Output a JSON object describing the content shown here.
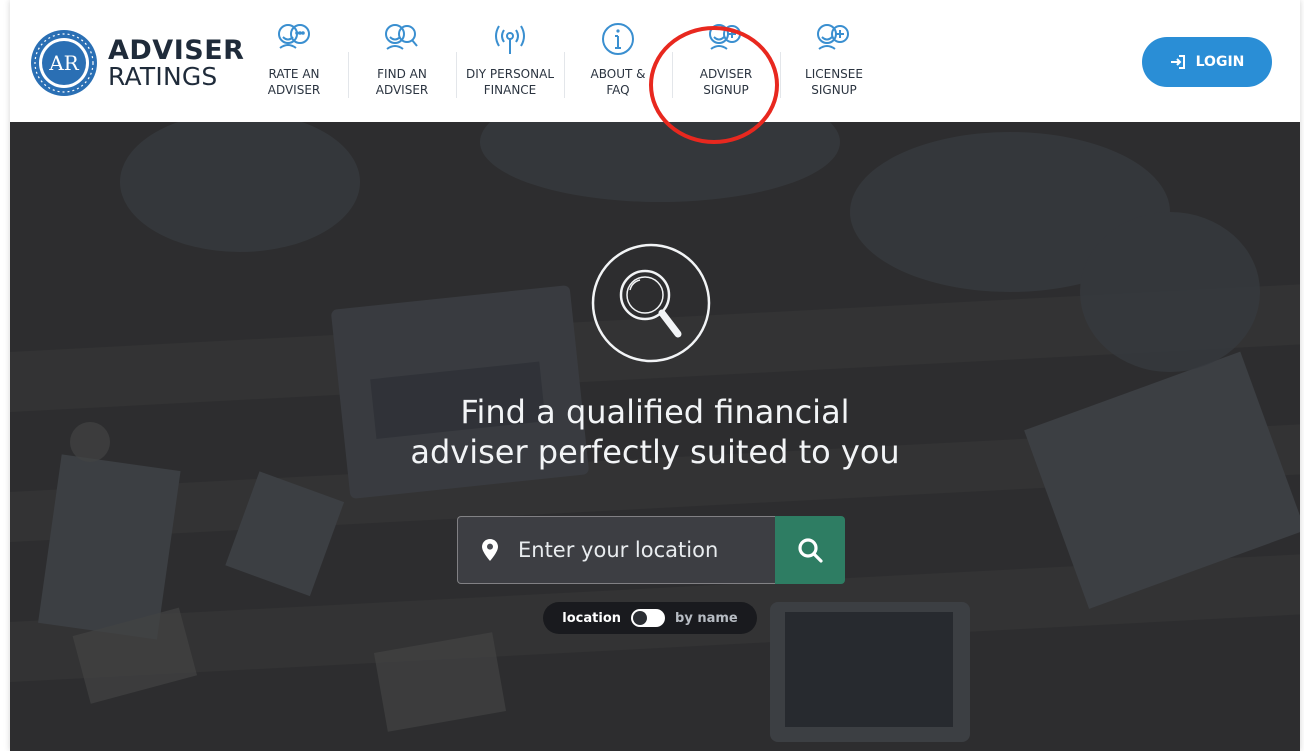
{
  "brand": {
    "seal_text": "AR",
    "name_line1": "ADVISER",
    "name_line2": "RATINGS",
    "seal_color": "#2a6fb4",
    "text_color": "#1f2b3a"
  },
  "nav": {
    "items": [
      {
        "line1": "RATE AN",
        "line2": "ADVISER",
        "icon": "people-chat-icon"
      },
      {
        "line1": "FIND AN",
        "line2": "ADVISER",
        "icon": "people-search-icon"
      },
      {
        "line1": "DIY PERSONAL",
        "line2": "FINANCE",
        "icon": "broadcast-icon"
      },
      {
        "line1": "ABOUT &",
        "line2": "FAQ",
        "icon": "info-icon"
      },
      {
        "line1": "ADVISER",
        "line2": "SIGNUP",
        "icon": "people-plus-icon"
      },
      {
        "line1": "LICENSEE",
        "line2": "SIGNUP",
        "icon": "people-plus-icon"
      }
    ],
    "icon_color": "#3a8fd0"
  },
  "login": {
    "label": "LOGIN",
    "icon": "sign-in-icon",
    "color": "#2a8ed6"
  },
  "hero": {
    "icon": "magnifier-icon",
    "title_line1": "Find a qualified financial",
    "title_line2": "adviser perfectly suited to you"
  },
  "search": {
    "placeholder": "Enter your location",
    "field_icon": "map-pin-icon",
    "button_icon": "search-icon",
    "button_color": "#2e7d63"
  },
  "toggle": {
    "left_label": "location",
    "right_label": "by name"
  },
  "annotation": {
    "color": "#e8281f"
  }
}
